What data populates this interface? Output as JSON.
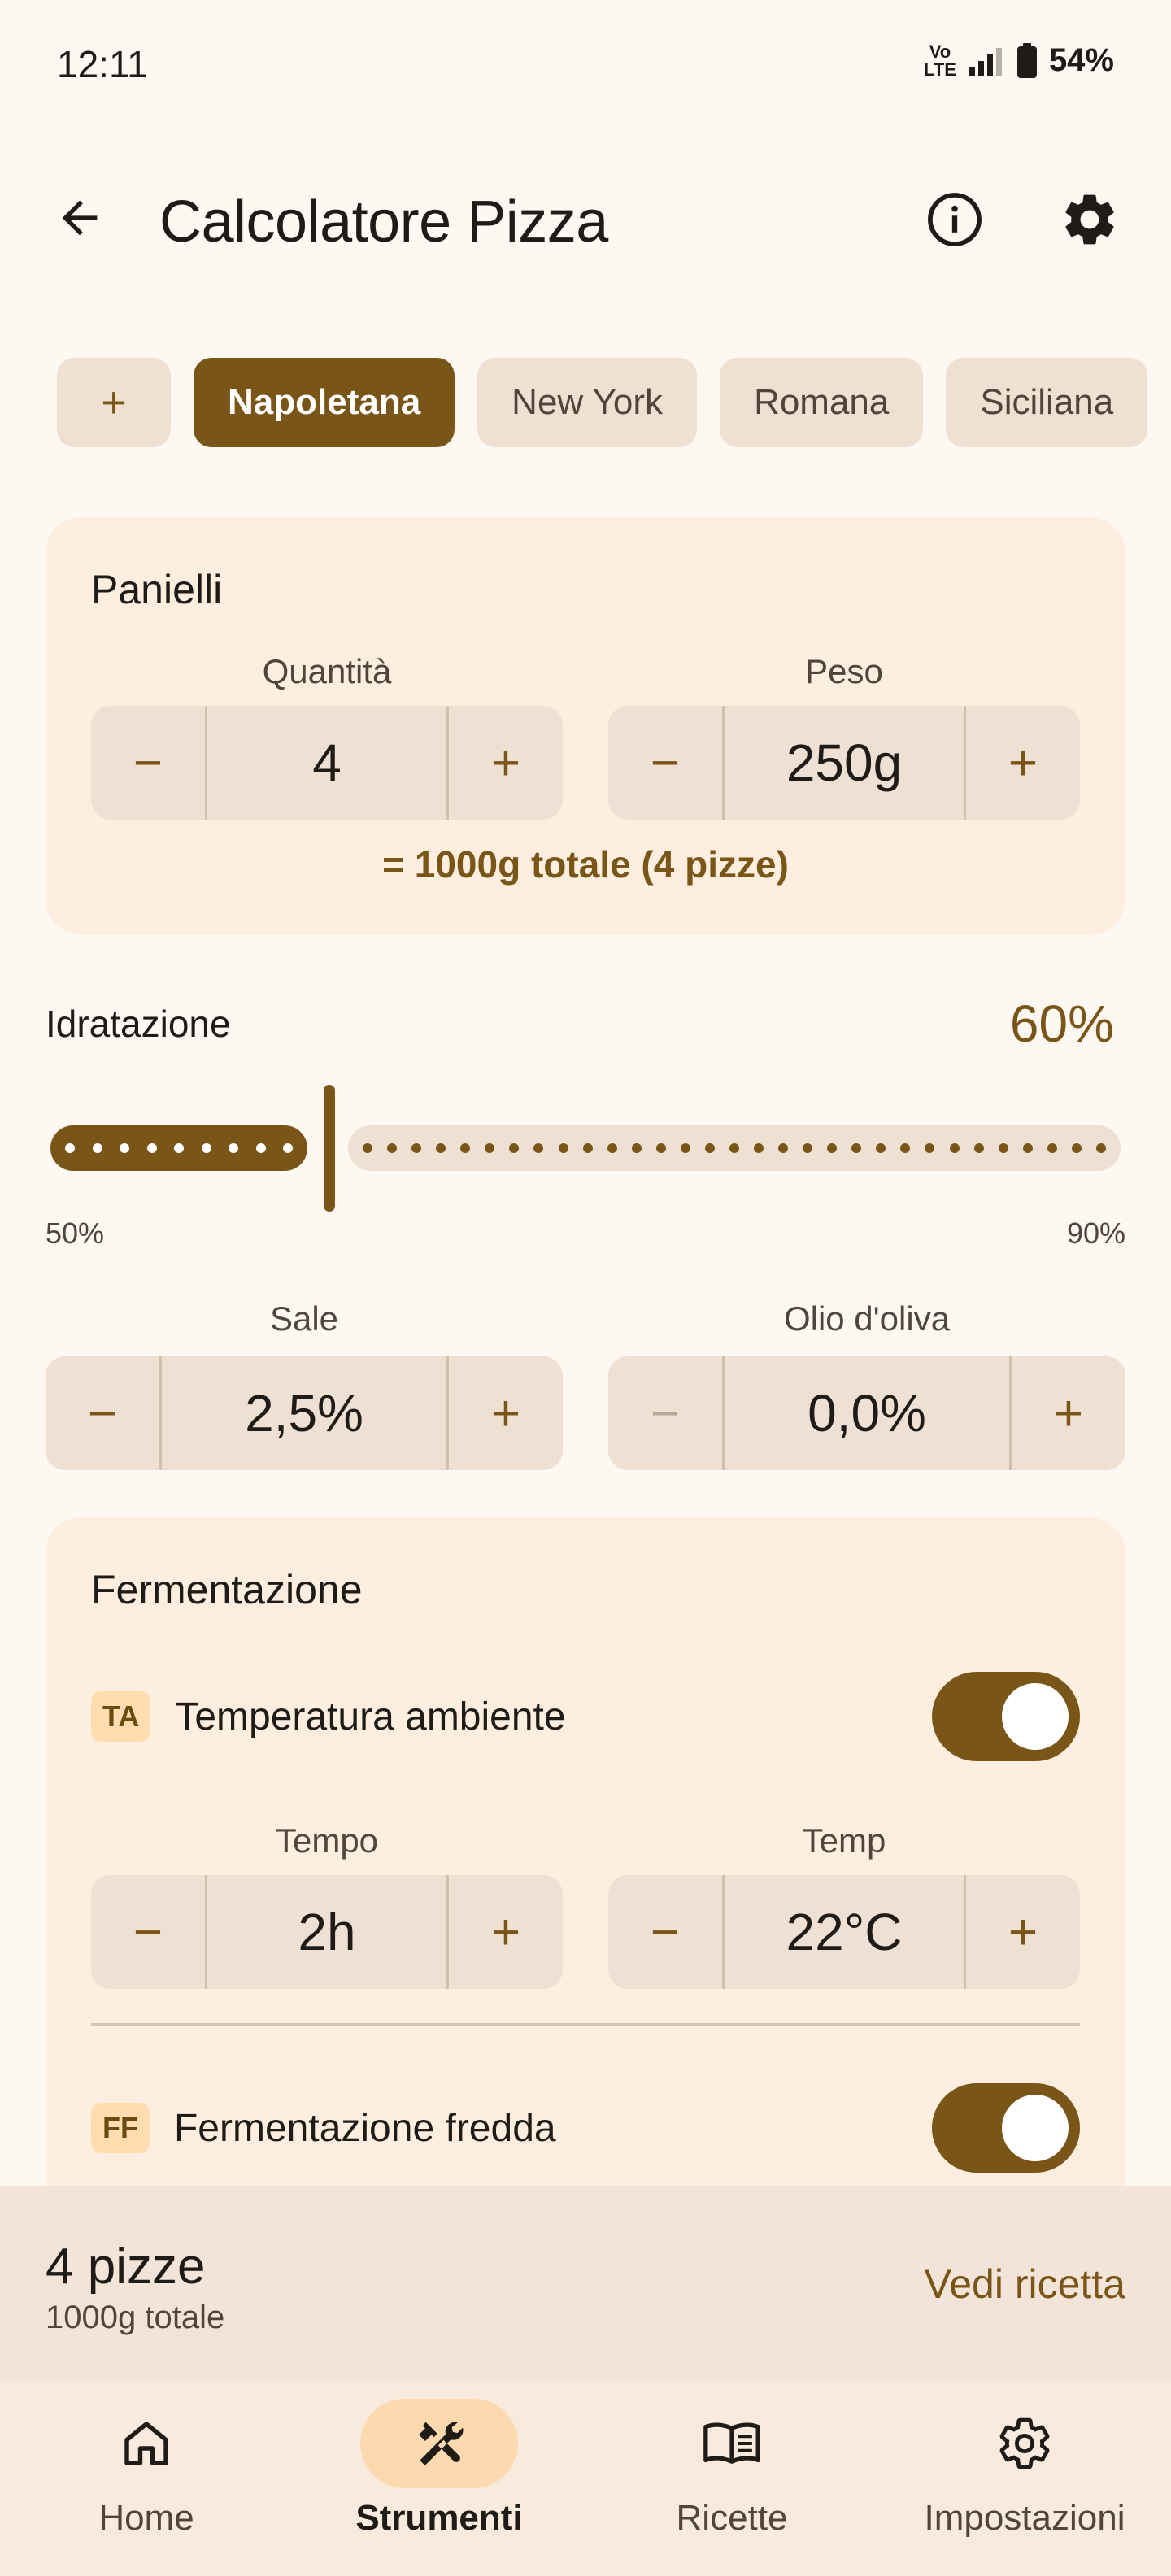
{
  "status": {
    "time": "12:11",
    "network": "VoLTE",
    "battery": "54%"
  },
  "app_bar": {
    "title": "Calcolatore Pizza",
    "back_icon": "arrow-back-icon",
    "info_icon": "info-icon",
    "settings_icon": "gear-icon"
  },
  "styles": {
    "add_label": "+",
    "items": [
      "Napoletana",
      "New York",
      "Romana",
      "Siciliana"
    ],
    "selected": "Napoletana"
  },
  "panielli": {
    "title": "Panielli",
    "quantity": {
      "label": "Quantità",
      "value": "4",
      "minus": "−",
      "plus": "+"
    },
    "weight": {
      "label": "Peso",
      "value": "250g",
      "minus": "−",
      "plus": "+"
    },
    "total": "= 1000g totale (4 pizze)"
  },
  "hydration": {
    "label": "Idratazione",
    "value": "60%",
    "min_label": "50%",
    "max_label": "90%",
    "fraction": 0.25
  },
  "salt": {
    "label": "Sale",
    "value": "2,5%",
    "minus": "−",
    "plus": "+"
  },
  "oil": {
    "label": "Olio d'oliva",
    "value": "0,0%",
    "minus": "−",
    "plus": "+"
  },
  "fermentation": {
    "title": "Fermentazione",
    "room": {
      "badge": "TA",
      "label": "Temperatura ambiente",
      "enabled": true,
      "time": {
        "label": "Tempo",
        "value": "2h",
        "minus": "−",
        "plus": "+"
      },
      "temp": {
        "label": "Temp",
        "value": "22°C",
        "minus": "−",
        "plus": "+"
      }
    },
    "cold": {
      "badge": "FF",
      "label": "Fermentazione fredda",
      "enabled": true
    }
  },
  "summary": {
    "title": "4 pizze",
    "subtitle": "1000g totale",
    "action": "Vedi ricetta"
  },
  "nav": {
    "items": [
      {
        "label": "Home",
        "icon": "home-icon"
      },
      {
        "label": "Strumenti",
        "icon": "tools-icon",
        "active": true
      },
      {
        "label": "Ricette",
        "icon": "book-icon"
      },
      {
        "label": "Impostazioni",
        "icon": "gear-icon"
      }
    ]
  },
  "colors": {
    "primary": "#7A5518",
    "background": "#FEF8F2",
    "card": "#FDEEE0",
    "stepper": "#EEE0D2"
  }
}
